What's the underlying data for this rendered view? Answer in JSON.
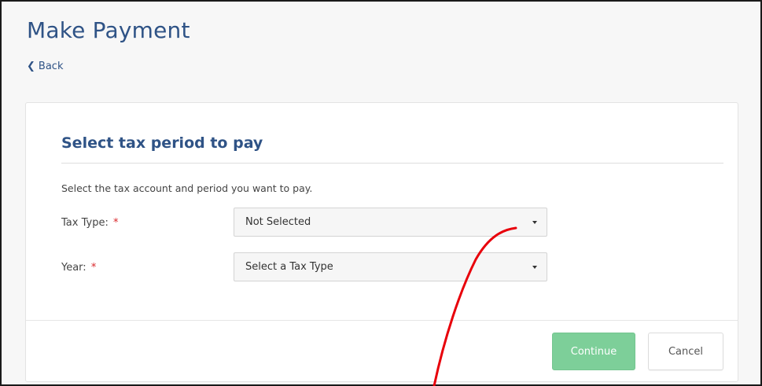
{
  "header": {
    "title": "Make Payment",
    "back_label": "Back"
  },
  "card": {
    "section_title": "Select tax period to pay",
    "instructions": "Select the tax account and period you want to pay.",
    "fields": [
      {
        "label": "Tax Type:",
        "required_mark": "*",
        "value": "Not Selected"
      },
      {
        "label": "Year:",
        "required_mark": "*",
        "value": "Select a Tax Type"
      }
    ]
  },
  "actions": {
    "continue_label": "Continue",
    "cancel_label": "Cancel"
  },
  "colors": {
    "title_blue": "#2f5386",
    "required_red": "#d9262a",
    "continue_green": "#7dcf99",
    "annotation_red": "#e8000b"
  },
  "icons": {
    "back": "chevron-left-icon",
    "dropdown": "caret-down-icon"
  }
}
